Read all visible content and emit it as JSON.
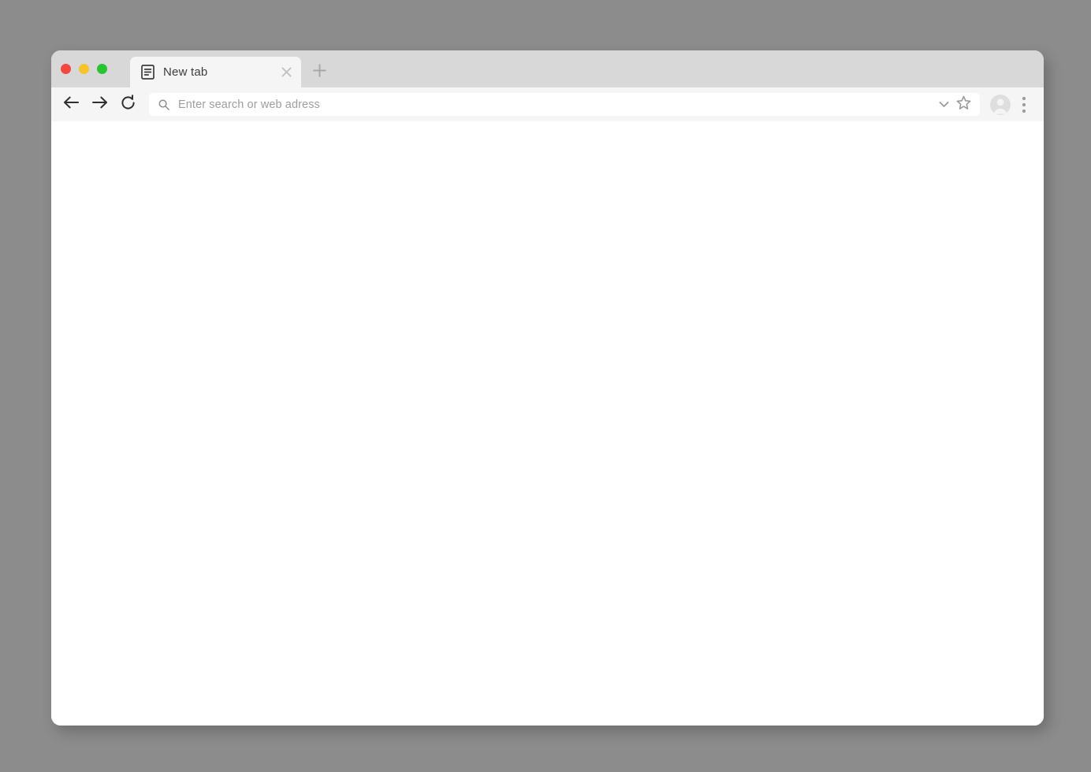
{
  "window": {
    "traffic_lights": [
      {
        "name": "close",
        "color": "#f4473f"
      },
      {
        "name": "minimize",
        "color": "#f6c32c"
      },
      {
        "name": "maximize",
        "color": "#29c431"
      }
    ],
    "background_color": "#8c8c8c",
    "titlebar_color": "#d8d8d8",
    "toolbar_color": "#f5f5f5",
    "content_color": "#ffffff"
  },
  "tabs": [
    {
      "title": "New tab",
      "favicon": "document-icon",
      "close_label": "×",
      "active": true
    }
  ],
  "newtab": {
    "label": "+",
    "icon": "plus-icon"
  },
  "toolbar": {
    "back": {
      "icon": "arrow-left-icon",
      "label": "Back"
    },
    "forward": {
      "icon": "arrow-right-icon",
      "label": "Forward"
    },
    "reload": {
      "icon": "reload-icon",
      "label": "Reload"
    }
  },
  "omnibox": {
    "search_icon": "search-icon",
    "value": "",
    "placeholder": "Enter search or web adress",
    "dropdown_icon": "chevron-down-icon",
    "bookmark_icon": "star-icon"
  },
  "profile": {
    "icon": "avatar-icon"
  },
  "menu": {
    "icon": "three-dots-icon"
  },
  "page": {
    "body_text": ""
  }
}
